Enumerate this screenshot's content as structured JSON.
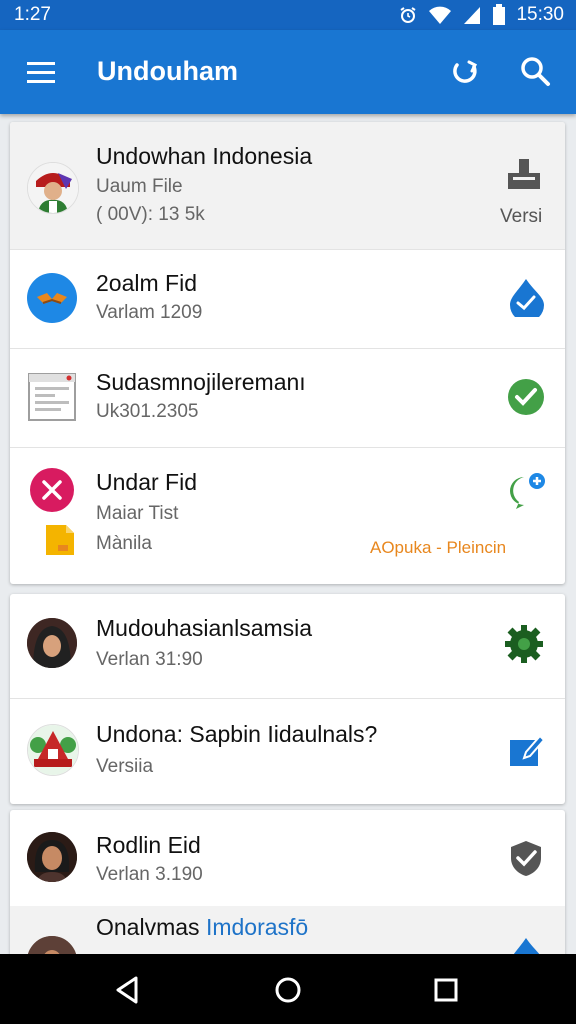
{
  "status": {
    "time_left": "1:27",
    "time_right": "15:30"
  },
  "appbar": {
    "title": "Undouham"
  },
  "items": [
    {
      "title": "Undowhan Indonesia",
      "subtitle": "Uaum File",
      "meta": "( 00V): 13 5k",
      "action_label": "Versi"
    },
    {
      "title": "2oalm Fid",
      "subtitle": "Varlam 1209"
    },
    {
      "title": "Sudasmnojileremanı",
      "subtitle": "Uk301.2305"
    },
    {
      "title": "Undar Fid",
      "subtitle": "Maiar Tist",
      "file_name": "Mànila",
      "link_text": "AOpuka - Pleincin"
    },
    {
      "title": "Mudouhasianlsamsia",
      "subtitle": "Verlan 31:90"
    },
    {
      "title": "Undona: Sapbin Iidaulnals?",
      "subtitle": "Versiia"
    },
    {
      "title": "Rodlin Eid",
      "subtitle": "Verlan 3.190"
    },
    {
      "title": "Onalvmas",
      "title_link": "Imdorasfō"
    }
  ],
  "colors": {
    "primary": "#1976d2",
    "status_bar": "#1565c0",
    "green": "#43a047",
    "red": "#d81b60",
    "orange": "#e8871e"
  },
  "nav": {
    "back": "back-icon",
    "home": "home-icon",
    "recents": "recents-icon"
  }
}
